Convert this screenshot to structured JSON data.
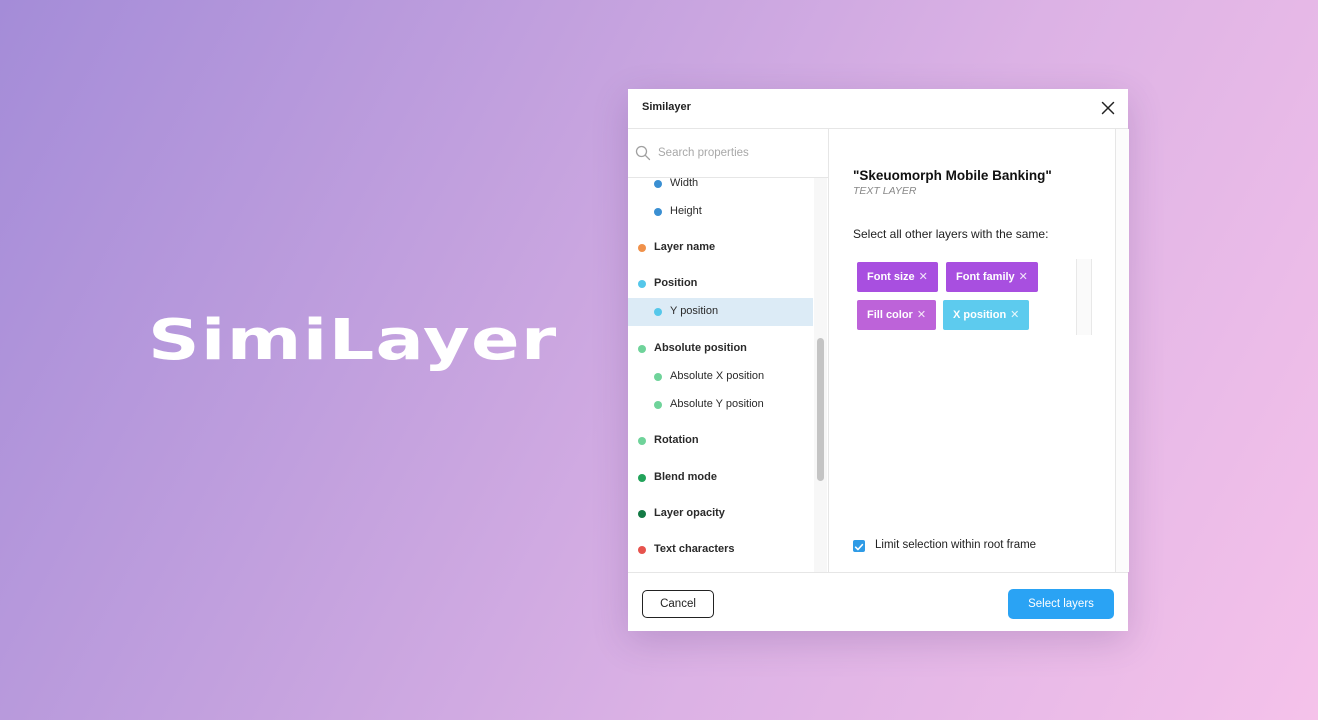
{
  "brand": {
    "wordmark": "SimiLayer"
  },
  "dialog": {
    "title": "Similayer",
    "search": {
      "placeholder": "Search properties",
      "value": ""
    },
    "properties": [
      {
        "label": "Width",
        "level": "child",
        "color": "#3a8fd2",
        "selected": false
      },
      {
        "label": "Height",
        "level": "child",
        "color": "#3a8fd2",
        "selected": false
      },
      {
        "label": "Layer name",
        "level": "parent",
        "color": "#f0914a",
        "selected": false
      },
      {
        "label": "Position",
        "level": "parent",
        "color": "#55c7ea",
        "selected": false
      },
      {
        "label": "Y position",
        "level": "child",
        "color": "#55c7ea",
        "selected": true
      },
      {
        "label": "Absolute position",
        "level": "parent",
        "color": "#6fd39a",
        "selected": false
      },
      {
        "label": "Absolute X position",
        "level": "child",
        "color": "#6fd39a",
        "selected": false
      },
      {
        "label": "Absolute Y position",
        "level": "child",
        "color": "#6fd39a",
        "selected": false
      },
      {
        "label": "Rotation",
        "level": "parent",
        "color": "#6fd39a",
        "selected": false
      },
      {
        "label": "Blend mode",
        "level": "parent",
        "color": "#22a35a",
        "selected": false
      },
      {
        "label": "Layer opacity",
        "level": "parent",
        "color": "#137a45",
        "selected": false
      },
      {
        "label": "Text characters",
        "level": "parent",
        "color": "#e7534d",
        "selected": false
      }
    ],
    "layer": {
      "name": "\"Skeuomorph Mobile Banking\"",
      "type": "TEXT LAYER"
    },
    "instruction": "Select all other layers with the same:",
    "chips": [
      {
        "label": "Font size",
        "remove": "✕",
        "color": "#a84fe0"
      },
      {
        "label": "Font family",
        "remove": "✕",
        "color": "#a84fe0"
      },
      {
        "label": "Fill color",
        "remove": "✕",
        "color": "#bd63d9"
      },
      {
        "label": "X position",
        "remove": "✕",
        "color": "#5dcbee"
      }
    ],
    "limit": {
      "label": "Limit selection within root frame",
      "checked": true
    },
    "buttons": {
      "cancel": "Cancel",
      "select": "Select layers"
    },
    "colors": {
      "primary": "#2aa3f4",
      "checkbox": "#2f9be6"
    }
  }
}
